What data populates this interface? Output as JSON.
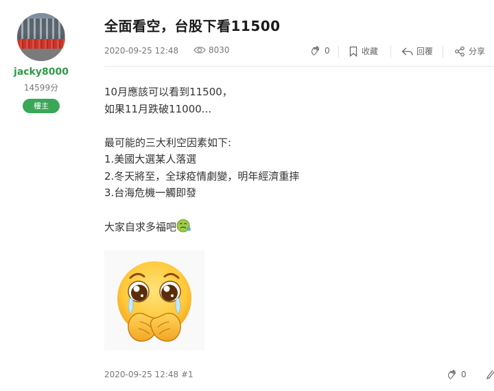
{
  "author": {
    "name": "jacky8000",
    "points": "14599分",
    "badge": "樓主"
  },
  "post": {
    "title": "全面看空，台股下看11500",
    "timestamp": "2020-09-25 12:48",
    "views": "8030",
    "likes": "0",
    "actions": {
      "bookmark": "收藏",
      "reply": "回覆",
      "share": "分享"
    },
    "body_lines": [
      "10月應該可以看到11500，",
      "如果11月跌破11000...",
      "",
      "最可能的三大利空因素如下:",
      "1.美國大選某人落選",
      "2.冬天將至，全球疫情劇變，明年經濟重摔",
      "3.台海危機一觸即發",
      "",
      "大家自求多福吧"
    ]
  },
  "footer": {
    "timestamp_floor": "2020-09-25 12:48 #1",
    "likes": "0"
  },
  "icons": {
    "views": "eye-icon",
    "like": "clap-icon",
    "bookmark": "bookmark-icon",
    "reply": "reply-arrow-icon",
    "share": "share-icon",
    "inline_emoji": "sick-face-emoji",
    "sticker": "pleading-face-sticker"
  },
  "colors": {
    "accent_green": "#3aa757",
    "username_green": "#2d9b45",
    "meta_gray": "#777777"
  }
}
